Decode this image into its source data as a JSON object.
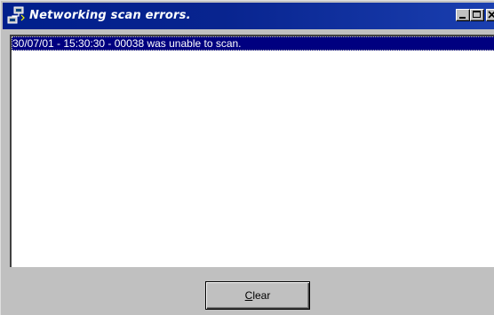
{
  "window": {
    "title": "Networking scan errors."
  },
  "list": {
    "items": [
      {
        "text": "30/07/01 - 15:30:30 - 00038 was unable to scan.",
        "selected": true
      }
    ]
  },
  "footer": {
    "clear_button": {
      "accel": "C",
      "rest": "lear"
    }
  },
  "colors": {
    "titlebar": "#001f8c",
    "selection": "#000080",
    "face": "#c0c0c0"
  }
}
